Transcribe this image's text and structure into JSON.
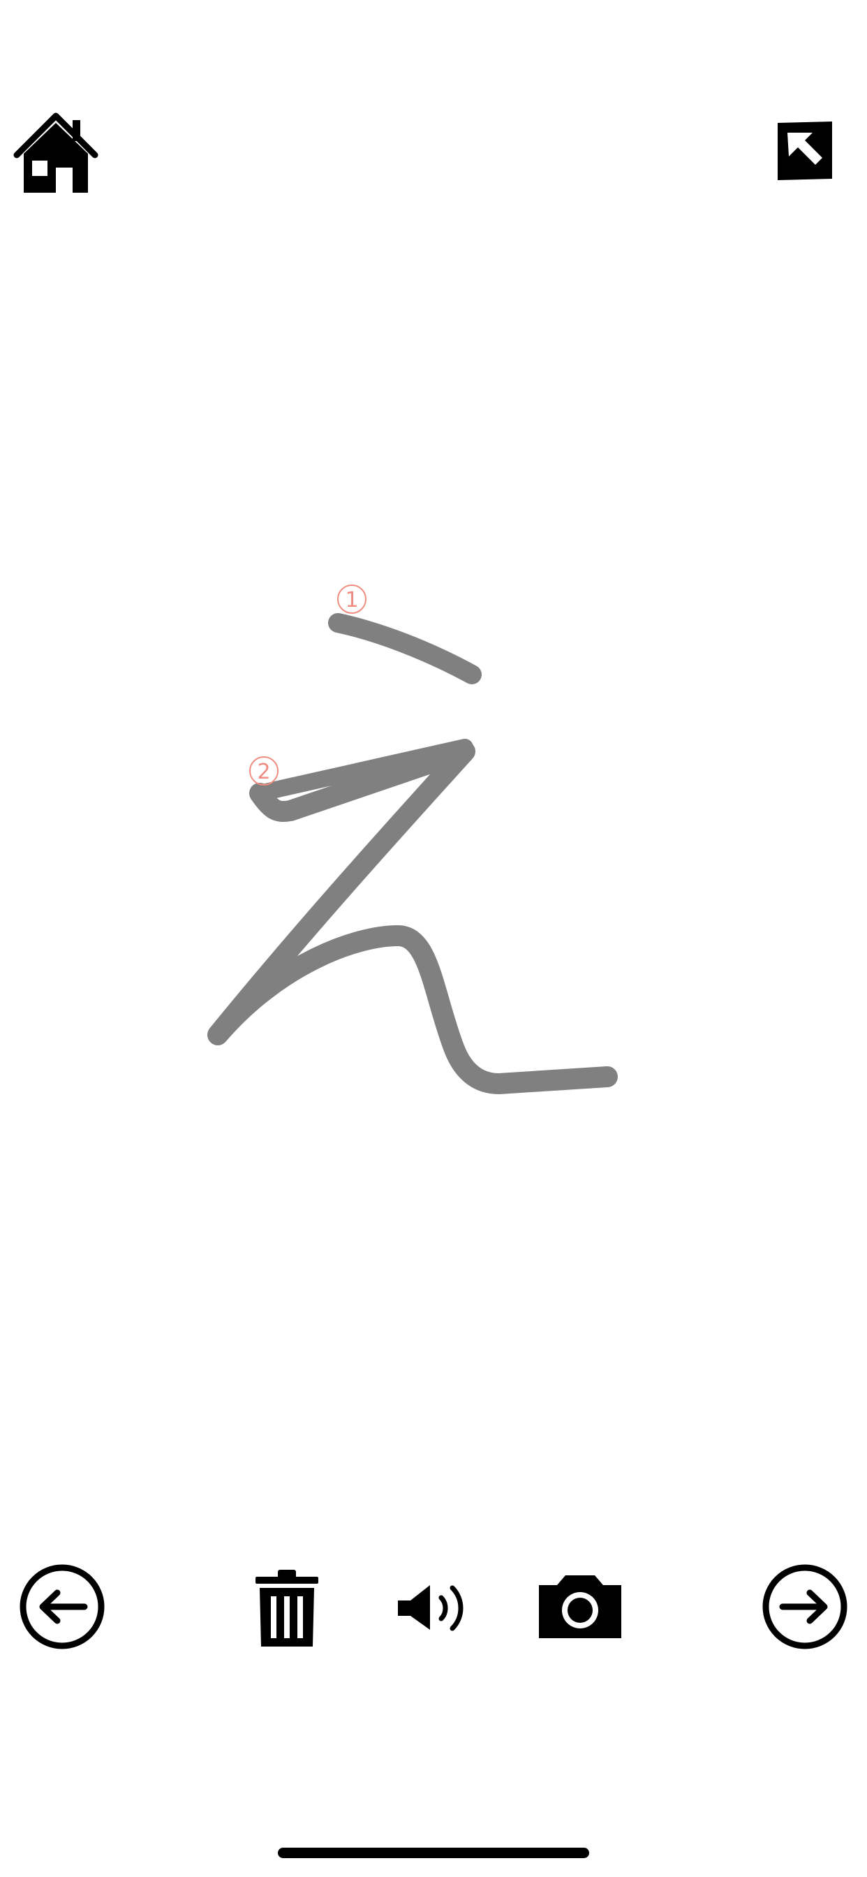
{
  "character": "え",
  "stroke_numbers": [
    {
      "label": "1"
    },
    {
      "label": "2"
    }
  ],
  "colors": {
    "stroke": "#808080",
    "stroke_number": "#f08c80",
    "icon": "#000000",
    "background": "#ffffff"
  },
  "icons": {
    "top_left": "home-icon",
    "top_right": "expand-arrow-icon",
    "bottom": [
      "arrow-left-circle-icon",
      "trash-icon",
      "speaker-icon",
      "camera-icon",
      "arrow-right-circle-icon"
    ]
  }
}
